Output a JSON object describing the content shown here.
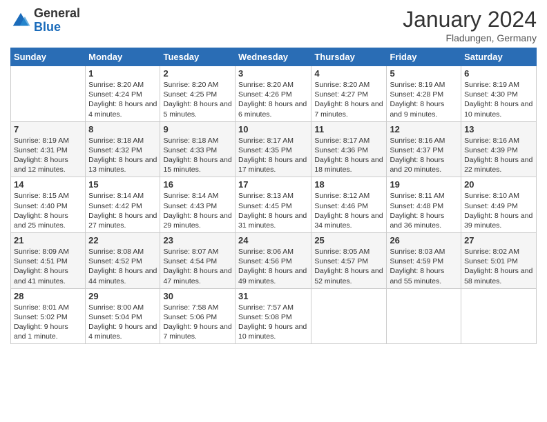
{
  "header": {
    "logo": {
      "general": "General",
      "blue": "Blue"
    },
    "title": "January 2024",
    "location": "Fladungen, Germany"
  },
  "days_of_week": [
    "Sunday",
    "Monday",
    "Tuesday",
    "Wednesday",
    "Thursday",
    "Friday",
    "Saturday"
  ],
  "weeks": [
    [
      {
        "day": "",
        "sunrise": "",
        "sunset": "",
        "daylight": ""
      },
      {
        "day": "1",
        "sunrise": "Sunrise: 8:20 AM",
        "sunset": "Sunset: 4:24 PM",
        "daylight": "Daylight: 8 hours and 4 minutes."
      },
      {
        "day": "2",
        "sunrise": "Sunrise: 8:20 AM",
        "sunset": "Sunset: 4:25 PM",
        "daylight": "Daylight: 8 hours and 5 minutes."
      },
      {
        "day": "3",
        "sunrise": "Sunrise: 8:20 AM",
        "sunset": "Sunset: 4:26 PM",
        "daylight": "Daylight: 8 hours and 6 minutes."
      },
      {
        "day": "4",
        "sunrise": "Sunrise: 8:20 AM",
        "sunset": "Sunset: 4:27 PM",
        "daylight": "Daylight: 8 hours and 7 minutes."
      },
      {
        "day": "5",
        "sunrise": "Sunrise: 8:19 AM",
        "sunset": "Sunset: 4:28 PM",
        "daylight": "Daylight: 8 hours and 9 minutes."
      },
      {
        "day": "6",
        "sunrise": "Sunrise: 8:19 AM",
        "sunset": "Sunset: 4:30 PM",
        "daylight": "Daylight: 8 hours and 10 minutes."
      }
    ],
    [
      {
        "day": "7",
        "sunrise": "Sunrise: 8:19 AM",
        "sunset": "Sunset: 4:31 PM",
        "daylight": "Daylight: 8 hours and 12 minutes."
      },
      {
        "day": "8",
        "sunrise": "Sunrise: 8:18 AM",
        "sunset": "Sunset: 4:32 PM",
        "daylight": "Daylight: 8 hours and 13 minutes."
      },
      {
        "day": "9",
        "sunrise": "Sunrise: 8:18 AM",
        "sunset": "Sunset: 4:33 PM",
        "daylight": "Daylight: 8 hours and 15 minutes."
      },
      {
        "day": "10",
        "sunrise": "Sunrise: 8:17 AM",
        "sunset": "Sunset: 4:35 PM",
        "daylight": "Daylight: 8 hours and 17 minutes."
      },
      {
        "day": "11",
        "sunrise": "Sunrise: 8:17 AM",
        "sunset": "Sunset: 4:36 PM",
        "daylight": "Daylight: 8 hours and 18 minutes."
      },
      {
        "day": "12",
        "sunrise": "Sunrise: 8:16 AM",
        "sunset": "Sunset: 4:37 PM",
        "daylight": "Daylight: 8 hours and 20 minutes."
      },
      {
        "day": "13",
        "sunrise": "Sunrise: 8:16 AM",
        "sunset": "Sunset: 4:39 PM",
        "daylight": "Daylight: 8 hours and 22 minutes."
      }
    ],
    [
      {
        "day": "14",
        "sunrise": "Sunrise: 8:15 AM",
        "sunset": "Sunset: 4:40 PM",
        "daylight": "Daylight: 8 hours and 25 minutes."
      },
      {
        "day": "15",
        "sunrise": "Sunrise: 8:14 AM",
        "sunset": "Sunset: 4:42 PM",
        "daylight": "Daylight: 8 hours and 27 minutes."
      },
      {
        "day": "16",
        "sunrise": "Sunrise: 8:14 AM",
        "sunset": "Sunset: 4:43 PM",
        "daylight": "Daylight: 8 hours and 29 minutes."
      },
      {
        "day": "17",
        "sunrise": "Sunrise: 8:13 AM",
        "sunset": "Sunset: 4:45 PM",
        "daylight": "Daylight: 8 hours and 31 minutes."
      },
      {
        "day": "18",
        "sunrise": "Sunrise: 8:12 AM",
        "sunset": "Sunset: 4:46 PM",
        "daylight": "Daylight: 8 hours and 34 minutes."
      },
      {
        "day": "19",
        "sunrise": "Sunrise: 8:11 AM",
        "sunset": "Sunset: 4:48 PM",
        "daylight": "Daylight: 8 hours and 36 minutes."
      },
      {
        "day": "20",
        "sunrise": "Sunrise: 8:10 AM",
        "sunset": "Sunset: 4:49 PM",
        "daylight": "Daylight: 8 hours and 39 minutes."
      }
    ],
    [
      {
        "day": "21",
        "sunrise": "Sunrise: 8:09 AM",
        "sunset": "Sunset: 4:51 PM",
        "daylight": "Daylight: 8 hours and 41 minutes."
      },
      {
        "day": "22",
        "sunrise": "Sunrise: 8:08 AM",
        "sunset": "Sunset: 4:52 PM",
        "daylight": "Daylight: 8 hours and 44 minutes."
      },
      {
        "day": "23",
        "sunrise": "Sunrise: 8:07 AM",
        "sunset": "Sunset: 4:54 PM",
        "daylight": "Daylight: 8 hours and 47 minutes."
      },
      {
        "day": "24",
        "sunrise": "Sunrise: 8:06 AM",
        "sunset": "Sunset: 4:56 PM",
        "daylight": "Daylight: 8 hours and 49 minutes."
      },
      {
        "day": "25",
        "sunrise": "Sunrise: 8:05 AM",
        "sunset": "Sunset: 4:57 PM",
        "daylight": "Daylight: 8 hours and 52 minutes."
      },
      {
        "day": "26",
        "sunrise": "Sunrise: 8:03 AM",
        "sunset": "Sunset: 4:59 PM",
        "daylight": "Daylight: 8 hours and 55 minutes."
      },
      {
        "day": "27",
        "sunrise": "Sunrise: 8:02 AM",
        "sunset": "Sunset: 5:01 PM",
        "daylight": "Daylight: 8 hours and 58 minutes."
      }
    ],
    [
      {
        "day": "28",
        "sunrise": "Sunrise: 8:01 AM",
        "sunset": "Sunset: 5:02 PM",
        "daylight": "Daylight: 9 hours and 1 minute."
      },
      {
        "day": "29",
        "sunrise": "Sunrise: 8:00 AM",
        "sunset": "Sunset: 5:04 PM",
        "daylight": "Daylight: 9 hours and 4 minutes."
      },
      {
        "day": "30",
        "sunrise": "Sunrise: 7:58 AM",
        "sunset": "Sunset: 5:06 PM",
        "daylight": "Daylight: 9 hours and 7 minutes."
      },
      {
        "day": "31",
        "sunrise": "Sunrise: 7:57 AM",
        "sunset": "Sunset: 5:08 PM",
        "daylight": "Daylight: 9 hours and 10 minutes."
      },
      {
        "day": "",
        "sunrise": "",
        "sunset": "",
        "daylight": ""
      },
      {
        "day": "",
        "sunrise": "",
        "sunset": "",
        "daylight": ""
      },
      {
        "day": "",
        "sunrise": "",
        "sunset": "",
        "daylight": ""
      }
    ]
  ]
}
